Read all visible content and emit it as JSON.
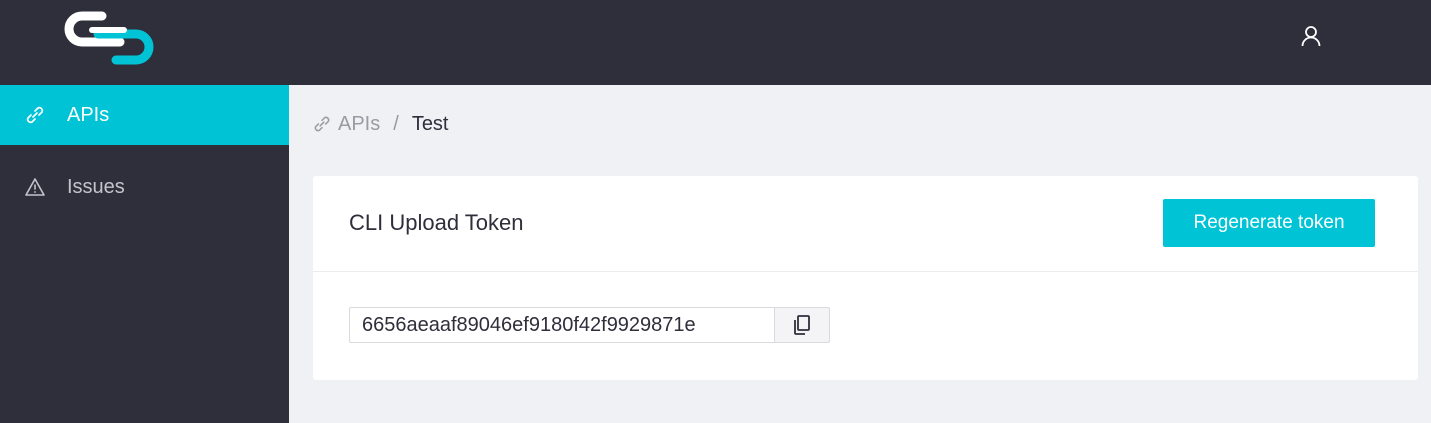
{
  "header": {
    "logo_icon": "app-logo",
    "user_icon": "user-icon"
  },
  "sidebar": {
    "items": [
      {
        "label": "APIs",
        "icon": "link-icon",
        "active": true
      },
      {
        "label": "Issues",
        "icon": "warning-icon",
        "active": false
      }
    ]
  },
  "breadcrumb": {
    "icon": "link-icon",
    "parent": "APIs",
    "separator": "/",
    "current": "Test"
  },
  "card": {
    "title": "CLI Upload Token",
    "regenerate_label": "Regenerate token",
    "token_value": "6656aeaaf89046ef9180f42f9929871e",
    "copy_icon": "copy-icon"
  },
  "colors": {
    "topbar": "#2f2e3b",
    "accent": "#00c4d6",
    "background": "#f0f1f5",
    "card": "#ffffff"
  }
}
